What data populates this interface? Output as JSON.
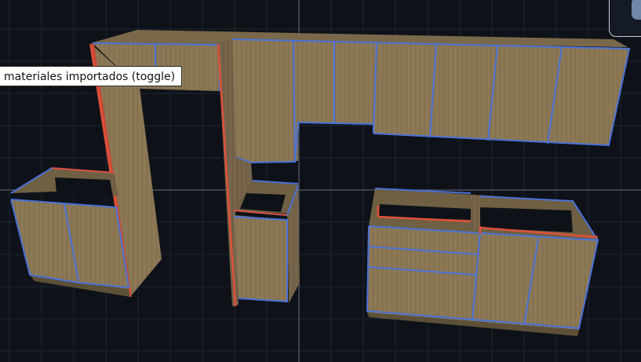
{
  "tooltip": {
    "text": "materiales importados (toggle)"
  },
  "colors": {
    "background": "#0e1218",
    "grid": "#1e2636",
    "axis": "#5a5f6a",
    "wood": "#8a7653",
    "wood_dark": "#6f5f43",
    "wood_light": "#9a8560",
    "edge_blue": "#4a72d8",
    "edge_red": "#e0503a"
  },
  "icons": {
    "corner_button": "panel-toggle-icon"
  }
}
